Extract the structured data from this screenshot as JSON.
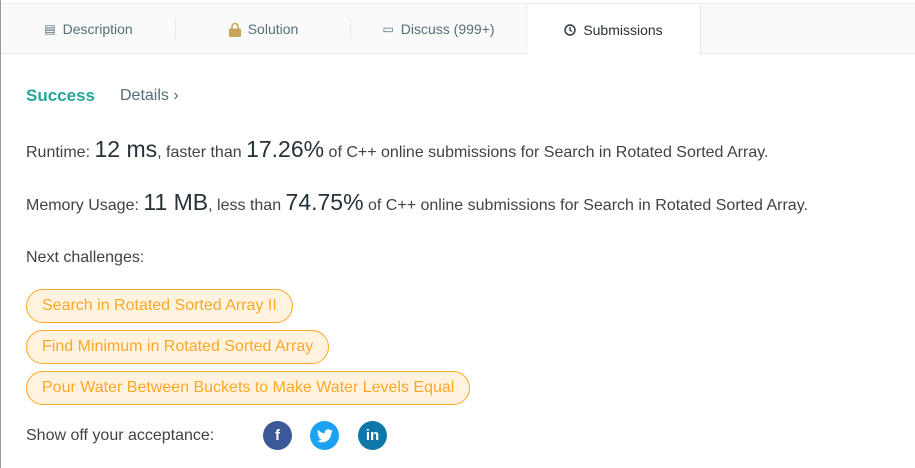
{
  "tabs": [
    {
      "label": "Description",
      "icon": "description-icon"
    },
    {
      "label": "Solution",
      "icon": "lock-icon"
    },
    {
      "label": "Discuss (999+)",
      "icon": "comment-icon"
    },
    {
      "label": "Submissions",
      "icon": "clock-icon"
    }
  ],
  "result": {
    "status": "Success",
    "details": "Details",
    "chevron": "›"
  },
  "runtime": {
    "label": "Runtime:",
    "value": "12 ms",
    "mid": ", faster than",
    "percent": "17.26%",
    "suffix": "of C++ online submissions for Search in Rotated Sorted Array."
  },
  "memory": {
    "label": "Memory Usage:",
    "value": "11 MB",
    "mid": ", less than",
    "percent": "74.75%",
    "suffix": "of C++ online submissions for Search in Rotated Sorted Array."
  },
  "next_label": "Next challenges:",
  "challenges": [
    "Search in Rotated Sorted Array II",
    "Find Minimum in Rotated Sorted Array",
    "Pour Water Between Buckets to Make Water Levels Equal"
  ],
  "share": {
    "label": "Show off your acceptance:",
    "facebook": "f",
    "twitter": "t",
    "linkedin": "in"
  },
  "colors": {
    "success": "#26a69a",
    "accent": "#ffa726",
    "facebook": "#3b5998",
    "twitter": "#1da1f2",
    "linkedin": "#0e76a8"
  }
}
